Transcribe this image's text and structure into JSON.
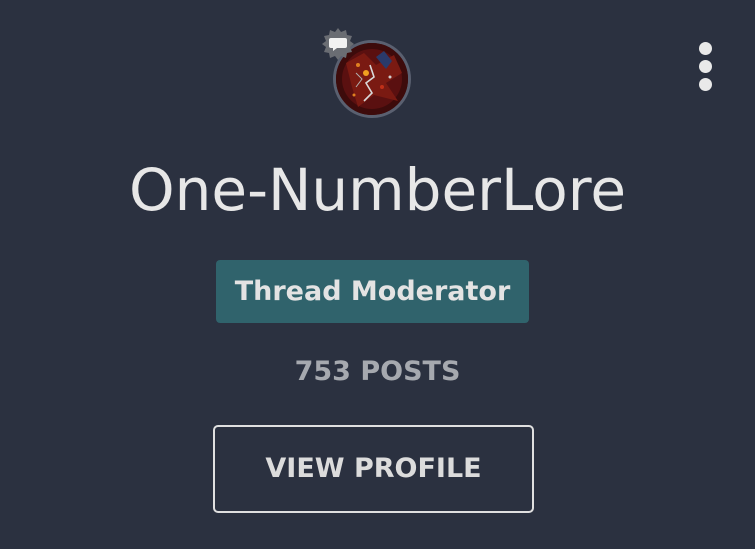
{
  "user": {
    "username": "One-NumberLore",
    "role_badge": "Thread Moderator",
    "posts": "753 POSTS"
  },
  "actions": {
    "view_profile_label": "VIEW PROFILE"
  },
  "icons": {
    "more": "more-vertical-icon",
    "chat": "chat-bubble-icon",
    "avatar": "avatar-image"
  },
  "colors": {
    "background": "#2b3140",
    "badge_background": "#30636c",
    "text_primary": "#e7e7e7",
    "text_muted": "#a6a9af"
  }
}
